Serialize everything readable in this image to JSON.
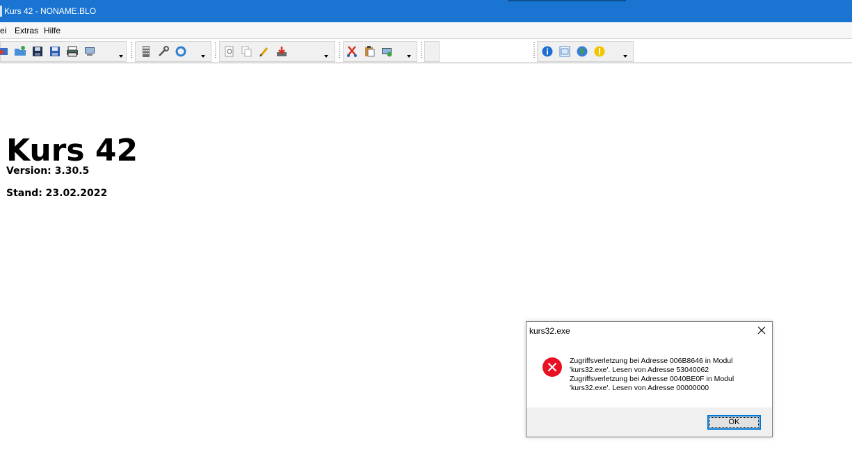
{
  "window": {
    "title": "Kurs 42 - NONAME.BLO"
  },
  "menu": {
    "items": [
      "ei",
      "Extras",
      "Hilfe"
    ]
  },
  "toolbar": {
    "icons": [
      "open-icon",
      "folder-icon",
      "save-icon",
      "save-as-icon",
      "print-icon",
      "monitor-icon",
      "calculator-icon",
      "tools-icon",
      "refresh-icon",
      "preview-icon",
      "copy-icon",
      "edit-icon",
      "import-icon",
      "cut-icon",
      "paste-icon",
      "display-icon",
      "info-icon",
      "window-icon",
      "globe-icon",
      "warning-icon"
    ]
  },
  "main": {
    "title": "Kurs 42",
    "version": "Version: 3.30.5",
    "stand": "Stand: 23.02.2022"
  },
  "dialog": {
    "title": "kurs32.exe",
    "message": "Zugriffsverletzung bei Adresse 006B8646 in Modul\n'kurs32.exe'. Lesen von Adresse 53040062\nZugriffsverletzung bei Adresse 0040BE0F in Modul\n'kurs32.exe'. Lesen von Adresse 00000000",
    "ok_label": "OK",
    "icon": "error-icon"
  },
  "colors": {
    "titlebar": "#1a75d2",
    "error": "#e81123",
    "focus": "#0078d7"
  }
}
